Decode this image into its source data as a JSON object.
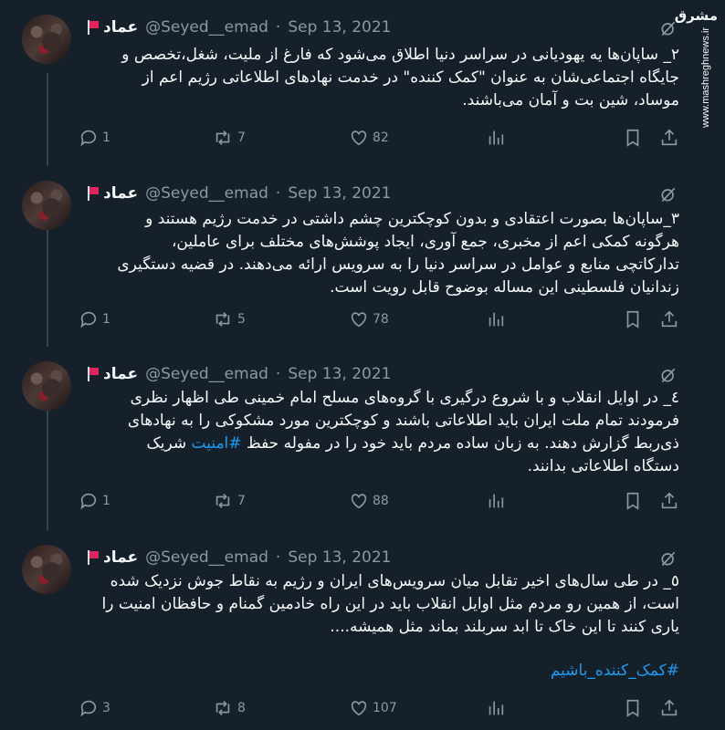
{
  "watermark": {
    "logo": "مشرق",
    "site": "www.mashreghnews.ir"
  },
  "author": {
    "display_name": "عماد",
    "handle": "@Seyed__emad",
    "separator": "·"
  },
  "tweets": [
    {
      "date": "Sep 13, 2021",
      "lines": [
        "٢_ ساپان‌ها یه یهودیانی در سراسر دنیا اطلاق می‌شود که فارغ از ملیت، شغل،تخصص و",
        "جایگاه اجتماعی‌شان به عنوان \"کمک کننده\" در خدمت نهادهای اطلاعاتی رژیم اعم از",
        "موساد، شین بت و آمان می‌باشند."
      ],
      "replies": "1",
      "retweets": "7",
      "likes": "82"
    },
    {
      "date": "Sep 13, 2021",
      "lines": [
        "٣_ساپان‌ها بصورت اعتقادی و بدون کوچکترین چشم داشتی در خدمت رژیم هستند و",
        "هرگونه کمکی اعم از مخبری، جمع آوری، ایجاد پوشش‌های مختلف برای عاملین،",
        "تدارکاتچی منابع و عوامل در سراسر دنیا را به سرویس ارائه می‌دهند. در قضیه دستگیری",
        "زندانیان فلسطینی این مساله بوضوح قابل رویت است."
      ],
      "replies": "1",
      "retweets": "5",
      "likes": "78"
    },
    {
      "date": "Sep 13, 2021",
      "lines": [
        "٤_ در اوایل انقلاب و با شروع درگیری با گروه‌های مسلح امام خمینی طی اظهار نظری",
        "فرمودند تمام ملت ایران باید اطلاعاتی باشند و کوچکترین مورد مشکوکی را به نهادهای",
        "ذی‌ربط گزارش دهند. به زبان ساده مردم باید خود را در مفوله حفظ",
        "دستگاه اطلاعاتی بدانند."
      ],
      "line3_hashtag": "#امنیت",
      "line3_tail": "شریک",
      "replies": "1",
      "retweets": "7",
      "likes": "88"
    },
    {
      "date": "Sep 13, 2021",
      "lines": [
        "٥_ در طی سال‌های اخیر تقابل میان سرویس‌های ایران و رژیم به نقاط جوش نزدیک شده",
        "است، از همین رو مردم مثل اوایل انقلاب باید در این راه خادمین گمنام و حافظان امنیت را",
        "یاری کنند تا این خاک تا ابد سربلند بماند مثل همیشه...."
      ],
      "hashtag": "#کمک_کننده_باشیم",
      "replies": "3",
      "retweets": "8",
      "likes": "107"
    }
  ],
  "colors": {
    "background": "#15202b",
    "text": "#f7f9f9",
    "muted": "#8b98a5",
    "link": "#1d9bf0",
    "thread": "#38444d"
  }
}
